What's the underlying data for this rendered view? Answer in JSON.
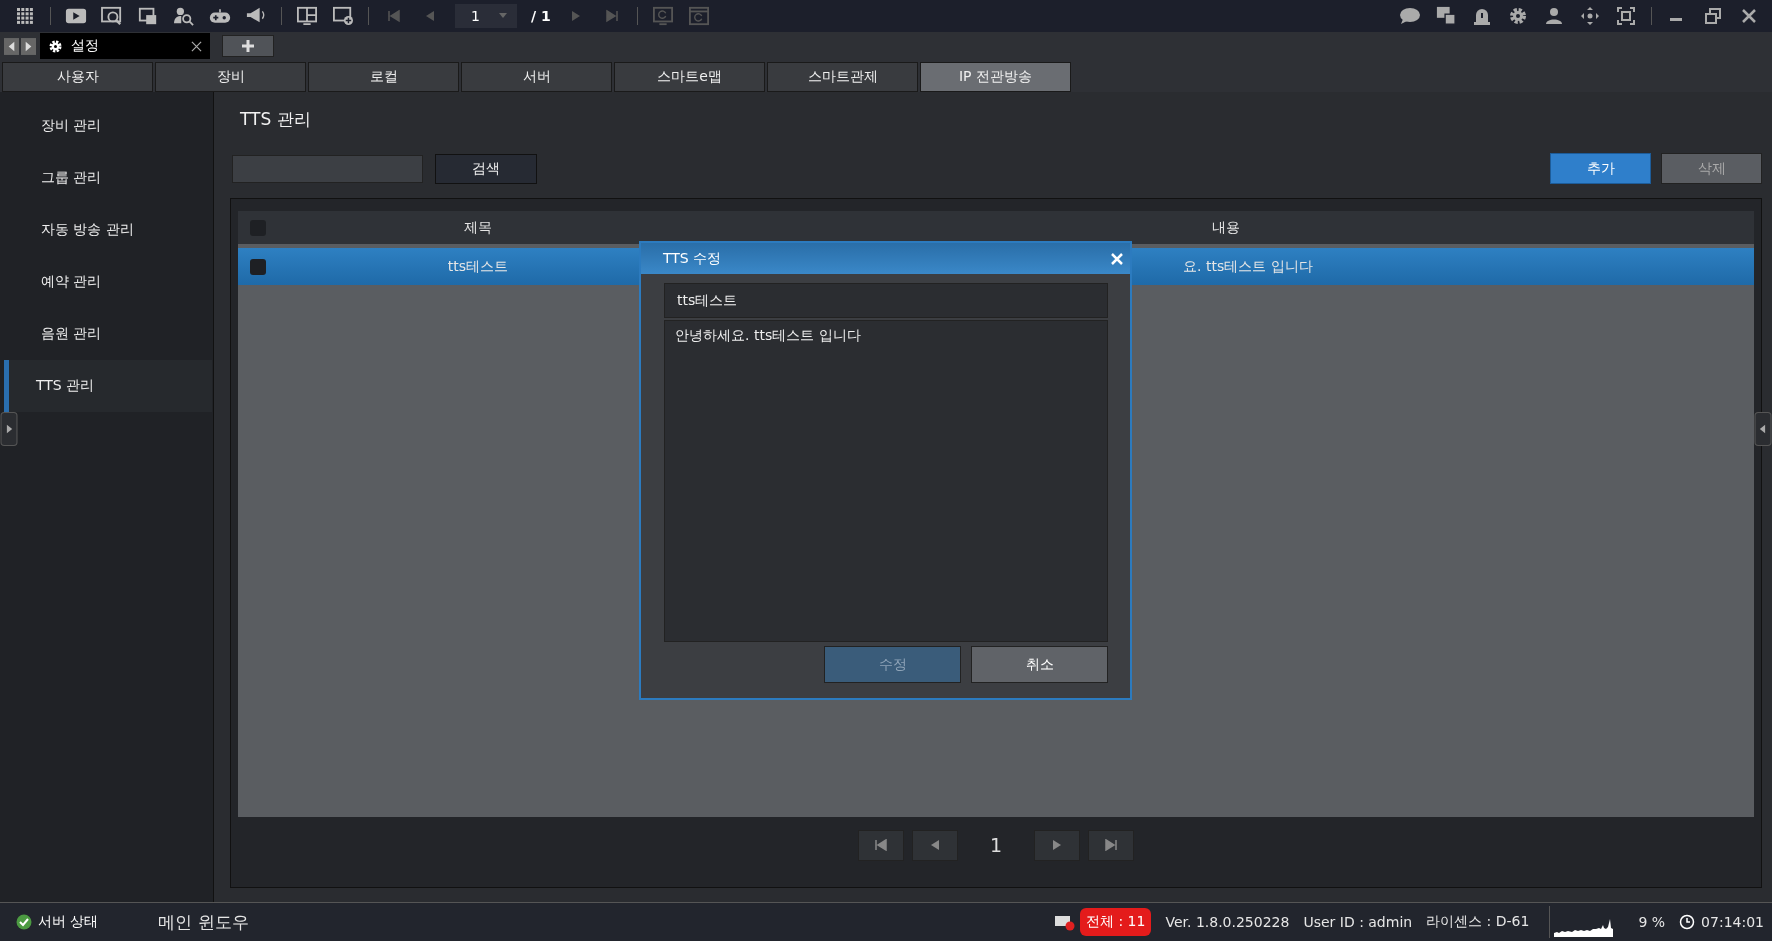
{
  "toolbar": {
    "page": "1",
    "total": "/ 1"
  },
  "window_tabs": [
    {
      "label": "설정",
      "selected": true
    }
  ],
  "categories": [
    {
      "label": "사용자",
      "selected": false
    },
    {
      "label": "장비",
      "selected": false
    },
    {
      "label": "로컬",
      "selected": false
    },
    {
      "label": "서버",
      "selected": false
    },
    {
      "label": "스마트e맵",
      "selected": false
    },
    {
      "label": "스마트관제",
      "selected": false
    },
    {
      "label": "IP 전관방송",
      "selected": true
    }
  ],
  "sidebar": {
    "items": [
      {
        "label": "장비 관리",
        "selected": false
      },
      {
        "label": "그룹 관리",
        "selected": false
      },
      {
        "label": "자동 방송 관리",
        "selected": false
      },
      {
        "label": "예약 관리",
        "selected": false
      },
      {
        "label": "음원 관리",
        "selected": false
      },
      {
        "label": "TTS 관리",
        "selected": true
      }
    ]
  },
  "content": {
    "title": "TTS 관리",
    "search_button": "검색",
    "add_button": "추가",
    "delete_button": "삭제",
    "delete_disabled": true
  },
  "table": {
    "columns": [
      "제목",
      "내용"
    ],
    "all_checked": false,
    "rows": [
      {
        "title": "tts테스트",
        "content": "요. tts테스트 입니다",
        "selected": true,
        "checked": false
      }
    ]
  },
  "pagination": {
    "page": "1"
  },
  "dialog": {
    "title": "TTS 수정",
    "name_value": "tts테스트",
    "text_value": "안녕하세요. tts테스트 입니다",
    "buttons": [
      {
        "label": "수정",
        "kind": "primary",
        "disabled": true
      },
      {
        "label": "취소",
        "kind": "secondary",
        "disabled": false
      }
    ]
  },
  "status_bar": {
    "server": "서버 상태",
    "window": "메인 윈도우",
    "total": "전체 : 11",
    "version": "Ver. 1.8.0.250228",
    "user": "User ID : admin",
    "license": "라이센스 : D-61",
    "cpu": "9 %",
    "time": "07:14:01"
  }
}
